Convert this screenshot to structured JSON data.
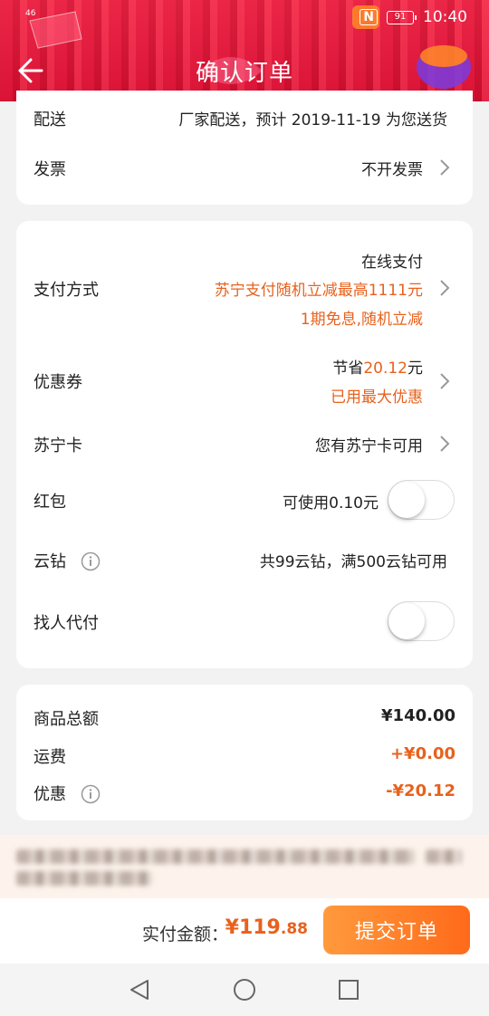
{
  "status_bar": {
    "signal": "46",
    "nfc": "N",
    "battery": "91",
    "time": "10:40"
  },
  "header": {
    "title": "确认订单"
  },
  "delivery_card": {
    "delivery_label": "配送",
    "delivery_value": "厂家配送，预计 2019-11-19 为您送货",
    "invoice_label": "发票",
    "invoice_value": "不开发票"
  },
  "payment_card": {
    "method_label": "支付方式",
    "method_value": "在线支付",
    "method_promo1": "苏宁支付随机立减最高1111元",
    "method_promo2": "1期免息,随机立减",
    "coupon_label": "优惠券",
    "coupon_prefix": "节省",
    "coupon_amount": "20.12",
    "coupon_suffix": "元",
    "coupon_note": "已用最大优惠",
    "card_label": "苏宁卡",
    "card_value": "您有苏宁卡可用",
    "redpacket_label": "红包",
    "redpacket_value": "可使用0.10元",
    "redpacket_on": false,
    "yunzuan_label": "云钻",
    "yunzuan_value": "共99云钻，满500云钻可用",
    "proxy_label": "找人代付",
    "proxy_on": false
  },
  "summary_card": {
    "total_label": "商品总额",
    "total_value": "¥140.00",
    "shipping_label": "运费",
    "shipping_value": "+¥0.00",
    "discount_label": "优惠",
    "discount_value": "-¥20.12"
  },
  "bottom_bar": {
    "pay_label": "实付金额：",
    "pay_currency": "¥",
    "pay_integer": "119",
    "pay_decimal": ".88",
    "submit_label": "提交订单"
  },
  "colors": {
    "accent": "#e8611d",
    "header": "#e01a3c",
    "button": "#ff7a22"
  }
}
